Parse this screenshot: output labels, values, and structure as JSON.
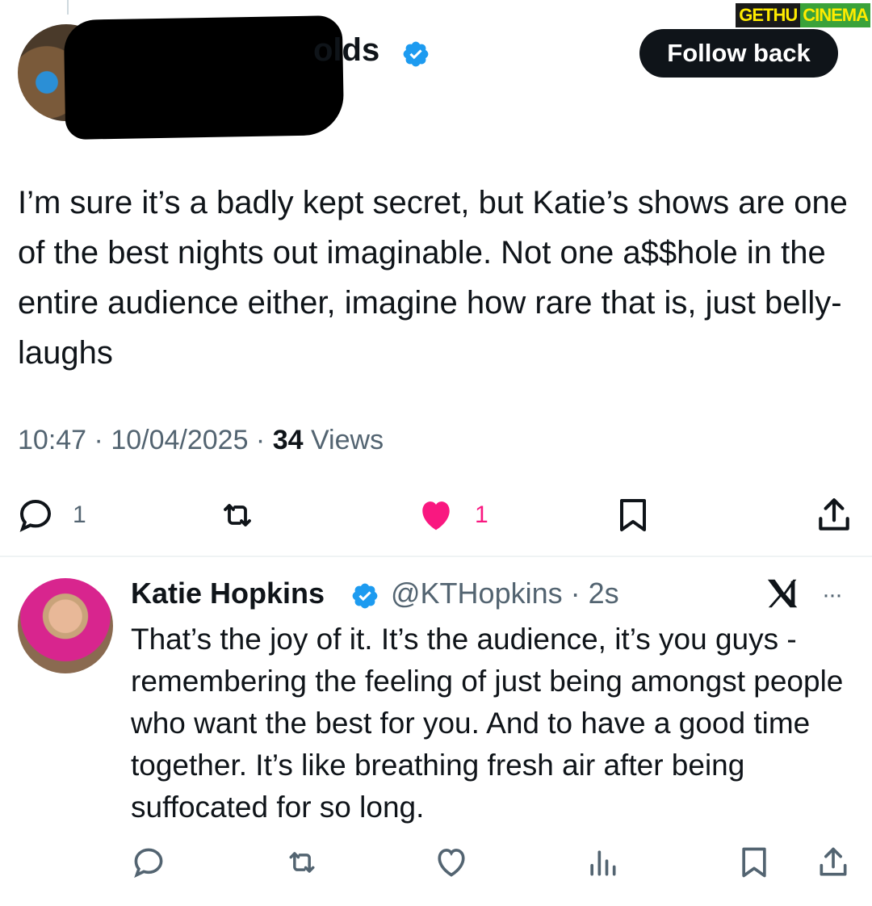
{
  "watermark": {
    "part1": "GETHU",
    "part2": "CINEMA"
  },
  "tweet": {
    "name_fragment": "olds",
    "follow_button": "Follow back",
    "text": "I’m sure it’s a badly kept secret, but Katie’s shows are one of the best nights out imaginable. Not one a$$hole in the entire audience either, imagine how rare that is, just belly-laughs",
    "time": "10:47",
    "date": "10/04/2025",
    "views_count": "34",
    "views_label": "Views",
    "reply_count": "1",
    "like_count": "1"
  },
  "reply": {
    "name": "Katie Hopkins",
    "handle": "@KTHopkins",
    "age": "2s",
    "more": "···",
    "text": "That’s the joy of it. It’s the audience, it’s you guys - remembering the feeling of just being amongst people who want the best for you. And to have a good time together. It’s like breathing fresh air after being suffocated for so long."
  },
  "colors": {
    "accent_blue": "#1d9bf0",
    "like_pink": "#f91880",
    "muted": "#536471",
    "text": "#0f1419"
  },
  "icons": [
    "reply-icon",
    "repost-icon",
    "heart-filled-icon",
    "bookmark-icon",
    "share-icon",
    "heart-icon",
    "views-icon",
    "verified-badge-icon",
    "x-logo-icon"
  ]
}
